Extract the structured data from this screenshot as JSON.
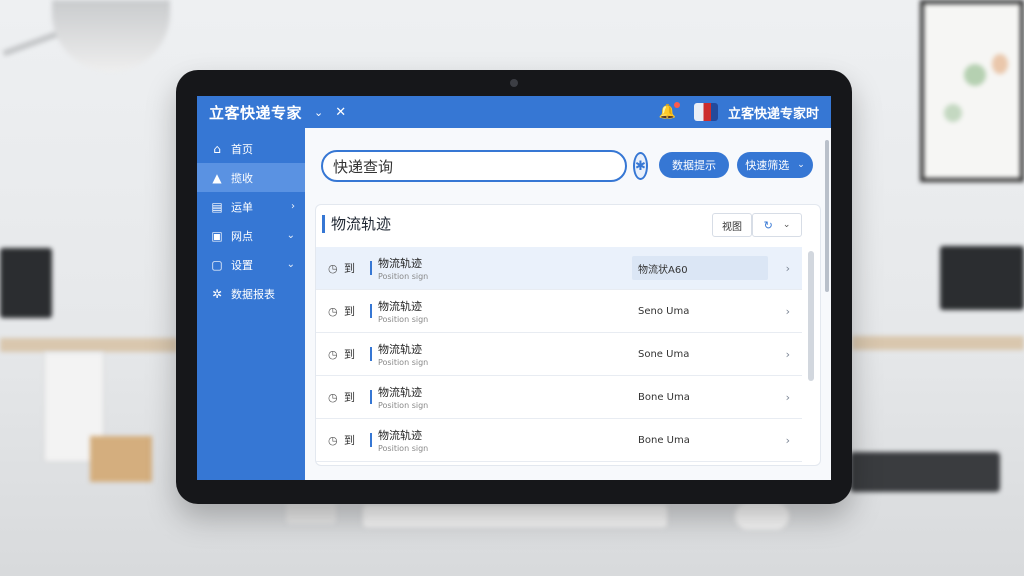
{
  "app": {
    "title": "立客快递专家",
    "user_name": "立客快递专家时",
    "accent_color": "#3677d4"
  },
  "sidebar": {
    "items": [
      {
        "label": "首页",
        "icon": "home-icon",
        "active": false,
        "has_chevron": false
      },
      {
        "label": "揽收",
        "icon": "house-filled-icon",
        "active": true,
        "has_chevron": false
      },
      {
        "label": "运单",
        "icon": "document-icon",
        "active": false,
        "has_chevron": true
      },
      {
        "label": "网点",
        "icon": "building-icon",
        "active": false,
        "has_chevron": true
      },
      {
        "label": "设置",
        "icon": "settings-icon",
        "active": false,
        "has_chevron": true
      },
      {
        "label": "数据报表",
        "icon": "chart-icon",
        "active": false,
        "has_chevron": false
      }
    ]
  },
  "search": {
    "value": "快递查询",
    "placeholder": "快递查询"
  },
  "toolbar": {
    "export_label": "数据提示",
    "filter_label": "快速筛选"
  },
  "panel": {
    "title": "物流轨迹",
    "view_label": "视图",
    "refresh_label": "↻"
  },
  "rows": [
    {
      "tag": "到",
      "title": "物流轨迹",
      "sub": "Position sign",
      "status": "物流状A60",
      "active": true
    },
    {
      "tag": "到",
      "title": "物流轨迹",
      "sub": "Position sign",
      "status": "Seno Uma",
      "active": false
    },
    {
      "tag": "到",
      "title": "物流轨迹",
      "sub": "Position sign",
      "status": "Sone Uma",
      "active": false
    },
    {
      "tag": "到",
      "title": "物流轨迹",
      "sub": "Position sign",
      "status": "Bone Uma",
      "active": false
    },
    {
      "tag": "到",
      "title": "物流轨迹",
      "sub": "Position sign",
      "status": "Bone Uma",
      "active": false
    }
  ]
}
